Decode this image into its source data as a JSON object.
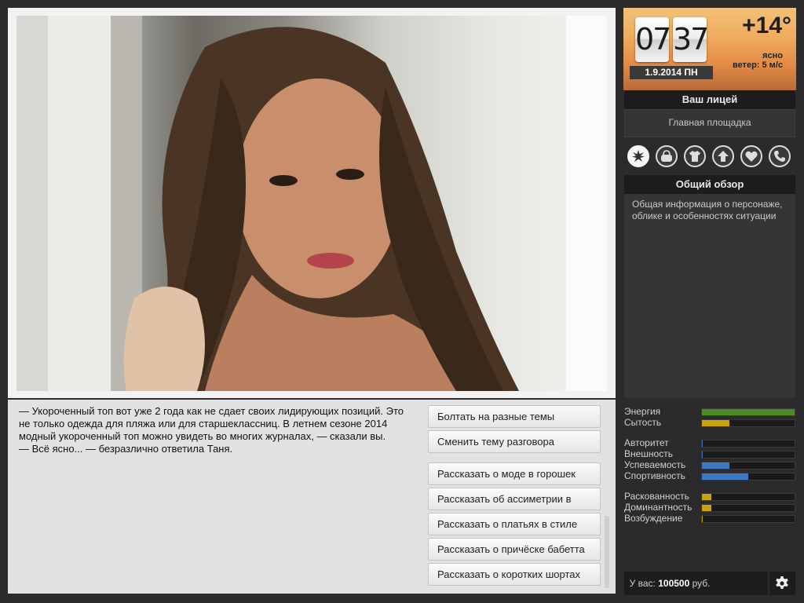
{
  "clock": {
    "hour": "07",
    "minute": "37",
    "date": "1.9.2014  ПН"
  },
  "weather": {
    "temperature": "+14°",
    "condition": "ясно",
    "wind": "ветер: 5 м/с"
  },
  "location": {
    "title": "Ваш лицей",
    "subtitle": "Главная площадка"
  },
  "tabs": {
    "icons": [
      "overview-icon",
      "bag-icon",
      "shirt-icon",
      "arrow-up-icon",
      "heart-icon",
      "phone-icon"
    ],
    "active_title": "Общий обзор",
    "active_description": "Общая информация о персонаже, облике и особенностях ситуации"
  },
  "dialog": {
    "text": "— Укороченный топ вот уже 2 года как не сдает своих лидирующих позиций. Это не только одежда для пляжа или для старшеклассниц. В летнем сезоне 2014 модный укороченный топ можно увидеть во многих журналах, — сказали вы.\n— Всё ясно... — безразлично ответила Таня."
  },
  "choices": [
    "Болтать на разные темы",
    "Сменить тему разговора",
    "Рассказать о моде в горошек",
    "Рассказать об ассиметрии в",
    "Рассказать о платьях в стиле",
    "Рассказать о причёске бабетта",
    "Рассказать о коротких шортах"
  ],
  "stats": [
    {
      "label": "Энергия",
      "value": 1.0,
      "color": "#4f8a2a"
    },
    {
      "label": "Сытость",
      "value": 0.3,
      "color": "#c9a20f"
    },
    {
      "label": "Авторитет",
      "value": 0.01,
      "color": "#3d78c4"
    },
    {
      "label": "Внешность",
      "value": 0.01,
      "color": "#3d78c4"
    },
    {
      "label": "Успеваемость",
      "value": 0.3,
      "color": "#3d78c4"
    },
    {
      "label": "Спортивность",
      "value": 0.5,
      "color": "#3d78c4"
    },
    {
      "label": "Раскованность",
      "value": 0.1,
      "color": "#c9a20f"
    },
    {
      "label": "Доминантность",
      "value": 0.1,
      "color": "#c9a20f"
    },
    {
      "label": "Возбуждение",
      "value": 0.0,
      "color": "#c9a20f"
    }
  ],
  "money": {
    "prefix": "У вас:",
    "amount": "100500",
    "currency": "руб."
  }
}
